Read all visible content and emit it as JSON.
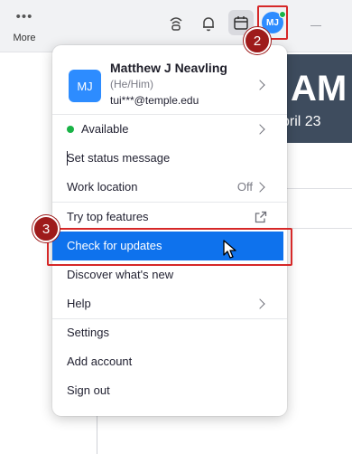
{
  "toolbar": {
    "more_label": "More",
    "avatar_initials": "MJ"
  },
  "banner": {
    "big_text": "AM",
    "date_text": "pril 23"
  },
  "profile": {
    "initials": "MJ",
    "name": "Matthew J Neavling",
    "pronouns": "(He/Him)",
    "email": "tui***@temple.edu"
  },
  "menu": {
    "status_label": "Available",
    "set_status_label": "Set status message",
    "work_location_label": "Work location",
    "work_location_value": "Off",
    "try_features_label": "Try top features",
    "check_updates_label": "Check for updates",
    "discover_label": "Discover what's new",
    "help_label": "Help",
    "settings_label": "Settings",
    "add_account_label": "Add account",
    "sign_out_label": "Sign out"
  },
  "annotations": {
    "step_2": "2",
    "step_3": "3"
  },
  "colors": {
    "accent": "#0e72ed",
    "avatar": "#2d8cff",
    "presence": "#19b346",
    "annotation": "#d62828"
  }
}
